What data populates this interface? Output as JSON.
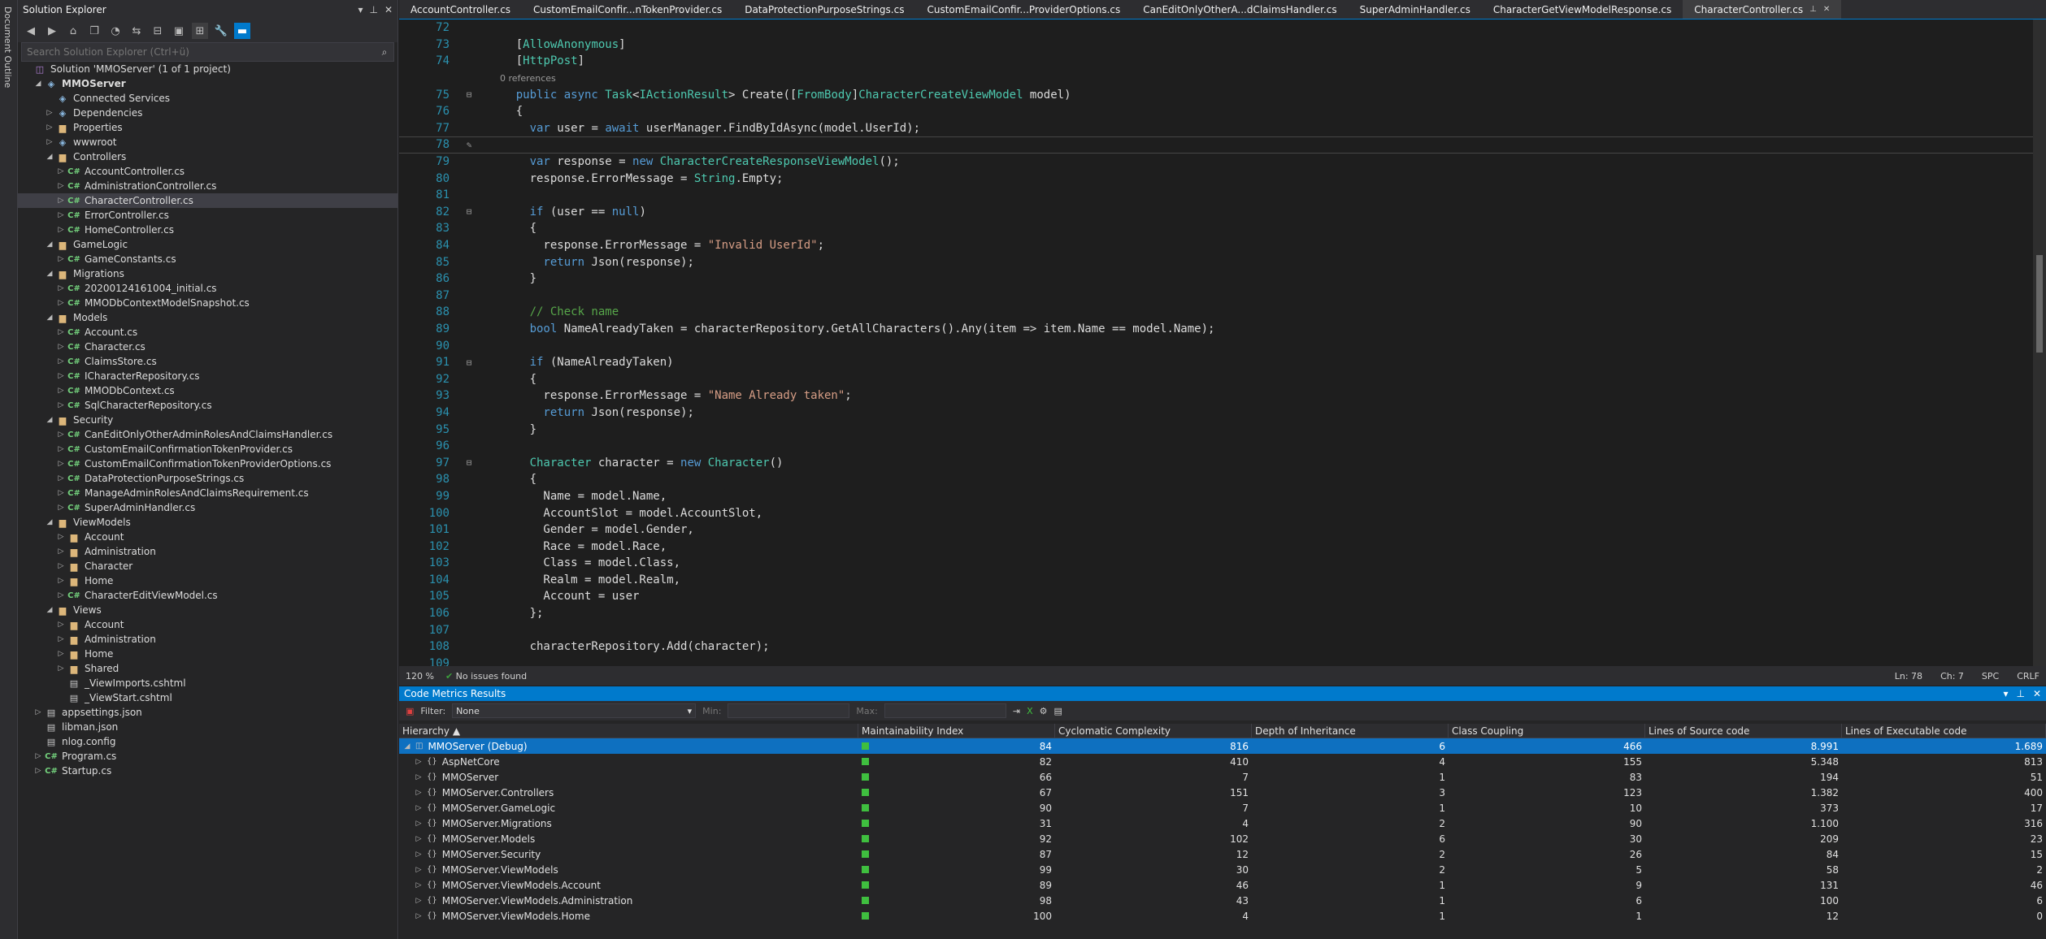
{
  "doc_outline": {
    "label": "Document Outline"
  },
  "solution_explorer": {
    "title": "Solution Explorer",
    "search_placeholder": "Search Solution Explorer (Ctrl+ü)",
    "tree": [
      {
        "label": "Solution 'MMOServer' (1 of 1 project)",
        "indent": 0,
        "icon": "sln",
        "arrow": ""
      },
      {
        "label": "MMOServer",
        "indent": 1,
        "icon": "proj",
        "arrow": "open",
        "bold": true
      },
      {
        "label": "Connected Services",
        "indent": 2,
        "icon": "proj",
        "arrow": ""
      },
      {
        "label": "Dependencies",
        "indent": 2,
        "icon": "proj",
        "arrow": "closed"
      },
      {
        "label": "Properties",
        "indent": 2,
        "icon": "folder",
        "arrow": "closed"
      },
      {
        "label": "wwwroot",
        "indent": 2,
        "icon": "proj",
        "arrow": "closed"
      },
      {
        "label": "Controllers",
        "indent": 2,
        "icon": "folder",
        "arrow": "open"
      },
      {
        "label": "AccountController.cs",
        "indent": 3,
        "icon": "cs",
        "arrow": "closed"
      },
      {
        "label": "AdministrationController.cs",
        "indent": 3,
        "icon": "cs",
        "arrow": "closed"
      },
      {
        "label": "CharacterController.cs",
        "indent": 3,
        "icon": "cs",
        "arrow": "closed",
        "selected": true
      },
      {
        "label": "ErrorController.cs",
        "indent": 3,
        "icon": "cs",
        "arrow": "closed"
      },
      {
        "label": "HomeController.cs",
        "indent": 3,
        "icon": "cs",
        "arrow": "closed"
      },
      {
        "label": "GameLogic",
        "indent": 2,
        "icon": "folder",
        "arrow": "open"
      },
      {
        "label": "GameConstants.cs",
        "indent": 3,
        "icon": "cs",
        "arrow": "closed"
      },
      {
        "label": "Migrations",
        "indent": 2,
        "icon": "folder",
        "arrow": "open"
      },
      {
        "label": "20200124161004_initial.cs",
        "indent": 3,
        "icon": "cs",
        "arrow": "closed"
      },
      {
        "label": "MMODbContextModelSnapshot.cs",
        "indent": 3,
        "icon": "cs",
        "arrow": "closed"
      },
      {
        "label": "Models",
        "indent": 2,
        "icon": "folder",
        "arrow": "open"
      },
      {
        "label": "Account.cs",
        "indent": 3,
        "icon": "cs",
        "arrow": "closed"
      },
      {
        "label": "Character.cs",
        "indent": 3,
        "icon": "cs",
        "arrow": "closed"
      },
      {
        "label": "ClaimsStore.cs",
        "indent": 3,
        "icon": "cs",
        "arrow": "closed"
      },
      {
        "label": "ICharacterRepository.cs",
        "indent": 3,
        "icon": "cs",
        "arrow": "closed"
      },
      {
        "label": "MMODbContext.cs",
        "indent": 3,
        "icon": "cs",
        "arrow": "closed"
      },
      {
        "label": "SqlCharacterRepository.cs",
        "indent": 3,
        "icon": "cs",
        "arrow": "closed"
      },
      {
        "label": "Security",
        "indent": 2,
        "icon": "folder",
        "arrow": "open"
      },
      {
        "label": "CanEditOnlyOtherAdminRolesAndClaimsHandler.cs",
        "indent": 3,
        "icon": "cs",
        "arrow": "closed"
      },
      {
        "label": "CustomEmailConfirmationTokenProvider.cs",
        "indent": 3,
        "icon": "cs",
        "arrow": "closed"
      },
      {
        "label": "CustomEmailConfirmationTokenProviderOptions.cs",
        "indent": 3,
        "icon": "cs",
        "arrow": "closed"
      },
      {
        "label": "DataProtectionPurposeStrings.cs",
        "indent": 3,
        "icon": "cs",
        "arrow": "closed"
      },
      {
        "label": "ManageAdminRolesAndClaimsRequirement.cs",
        "indent": 3,
        "icon": "cs",
        "arrow": "closed"
      },
      {
        "label": "SuperAdminHandler.cs",
        "indent": 3,
        "icon": "cs",
        "arrow": "closed"
      },
      {
        "label": "ViewModels",
        "indent": 2,
        "icon": "folder",
        "arrow": "open"
      },
      {
        "label": "Account",
        "indent": 3,
        "icon": "folder",
        "arrow": "closed"
      },
      {
        "label": "Administration",
        "indent": 3,
        "icon": "folder",
        "arrow": "closed"
      },
      {
        "label": "Character",
        "indent": 3,
        "icon": "folder",
        "arrow": "closed"
      },
      {
        "label": "Home",
        "indent": 3,
        "icon": "folder",
        "arrow": "closed"
      },
      {
        "label": "CharacterEditViewModel.cs",
        "indent": 3,
        "icon": "cs",
        "arrow": "closed"
      },
      {
        "label": "Views",
        "indent": 2,
        "icon": "folder",
        "arrow": "open"
      },
      {
        "label": "Account",
        "indent": 3,
        "icon": "folder",
        "arrow": "closed"
      },
      {
        "label": "Administration",
        "indent": 3,
        "icon": "folder",
        "arrow": "closed"
      },
      {
        "label": "Home",
        "indent": 3,
        "icon": "folder",
        "arrow": "closed"
      },
      {
        "label": "Shared",
        "indent": 3,
        "icon": "folder",
        "arrow": "closed"
      },
      {
        "label": "_ViewImports.cshtml",
        "indent": 3,
        "icon": "file",
        "arrow": ""
      },
      {
        "label": "_ViewStart.cshtml",
        "indent": 3,
        "icon": "file",
        "arrow": ""
      },
      {
        "label": "appsettings.json",
        "indent": 1,
        "icon": "file",
        "arrow": "closed"
      },
      {
        "label": "libman.json",
        "indent": 1,
        "icon": "file",
        "arrow": ""
      },
      {
        "label": "nlog.config",
        "indent": 1,
        "icon": "file",
        "arrow": ""
      },
      {
        "label": "Program.cs",
        "indent": 1,
        "icon": "cs",
        "arrow": "closed"
      },
      {
        "label": "Startup.cs",
        "indent": 1,
        "icon": "cs",
        "arrow": "closed"
      }
    ]
  },
  "tabs": [
    {
      "label": "AccountController.cs",
      "active": false
    },
    {
      "label": "CustomEmailConfir...nTokenProvider.cs",
      "active": false
    },
    {
      "label": "DataProtectionPurposeStrings.cs",
      "active": false
    },
    {
      "label": "CustomEmailConfir...ProviderOptions.cs",
      "active": false
    },
    {
      "label": "CanEditOnlyOtherA...dClaimsHandler.cs",
      "active": false
    },
    {
      "label": "SuperAdminHandler.cs",
      "active": false
    },
    {
      "label": "CharacterGetViewModelResponse.cs",
      "active": false
    },
    {
      "label": "CharacterController.cs",
      "active": true
    }
  ],
  "code_lines": [
    {
      "n": "72",
      "parts": [
        [
          "t",
          ""
        ]
      ]
    },
    {
      "n": "73",
      "parts": [
        [
          "t",
          "    ["
        ],
        [
          "ty",
          "AllowAnonymous"
        ],
        [
          "t",
          "]"
        ]
      ]
    },
    {
      "n": "74",
      "parts": [
        [
          "t",
          "    ["
        ],
        [
          "ty",
          "HttpPost"
        ],
        [
          "t",
          "]"
        ]
      ]
    },
    {
      "n": "",
      "parts": [
        [
          "rf",
          "    0 references"
        ]
      ]
    },
    {
      "n": "75",
      "fold": true,
      "parts": [
        [
          "kw",
          "    public async "
        ],
        [
          "ty",
          "Task"
        ],
        [
          "t",
          "<"
        ],
        [
          "ty",
          "IActionResult"
        ],
        [
          "t",
          "> Create(["
        ],
        [
          "ty",
          "FromBody"
        ],
        [
          "t",
          "]"
        ],
        [
          "ty",
          "CharacterCreateViewModel"
        ],
        [
          "t",
          " model)"
        ]
      ]
    },
    {
      "n": "76",
      "parts": [
        [
          "t",
          "    {"
        ]
      ]
    },
    {
      "n": "77",
      "parts": [
        [
          "kw",
          "      var "
        ],
        [
          "t",
          "user = "
        ],
        [
          "kw",
          "await "
        ],
        [
          "t",
          "userManager.FindByIdAsync(model.UserId);"
        ]
      ]
    },
    {
      "n": "78",
      "cur": true,
      "parts": [
        [
          "t",
          ""
        ]
      ]
    },
    {
      "n": "79",
      "parts": [
        [
          "kw",
          "      var "
        ],
        [
          "t",
          "response = "
        ],
        [
          "kw",
          "new "
        ],
        [
          "ty",
          "CharacterCreateResponseViewModel"
        ],
        [
          "t",
          "();"
        ]
      ]
    },
    {
      "n": "80",
      "parts": [
        [
          "t",
          "      response.ErrorMessage = "
        ],
        [
          "ty",
          "String"
        ],
        [
          "t",
          ".Empty;"
        ]
      ]
    },
    {
      "n": "81",
      "parts": [
        [
          "t",
          ""
        ]
      ]
    },
    {
      "n": "82",
      "fold": true,
      "parts": [
        [
          "kw",
          "      if "
        ],
        [
          "t",
          "(user == "
        ],
        [
          "kw",
          "null"
        ],
        [
          "t",
          ")"
        ]
      ]
    },
    {
      "n": "83",
      "parts": [
        [
          "t",
          "      {"
        ]
      ]
    },
    {
      "n": "84",
      "parts": [
        [
          "t",
          "        response.ErrorMessage = "
        ],
        [
          "st",
          "\"Invalid UserId\""
        ],
        [
          "t",
          ";"
        ]
      ]
    },
    {
      "n": "85",
      "parts": [
        [
          "kw",
          "        return "
        ],
        [
          "t",
          "Json(response);"
        ]
      ]
    },
    {
      "n": "86",
      "parts": [
        [
          "t",
          "      }"
        ]
      ]
    },
    {
      "n": "87",
      "parts": [
        [
          "t",
          ""
        ]
      ]
    },
    {
      "n": "88",
      "parts": [
        [
          "cm",
          "      // Check name"
        ]
      ]
    },
    {
      "n": "89",
      "parts": [
        [
          "kw",
          "      bool "
        ],
        [
          "t",
          "NameAlreadyTaken = characterRepository.GetAllCharacters().Any(item => item.Name == model.Name);"
        ]
      ]
    },
    {
      "n": "90",
      "parts": [
        [
          "t",
          ""
        ]
      ]
    },
    {
      "n": "91",
      "fold": true,
      "parts": [
        [
          "kw",
          "      if "
        ],
        [
          "t",
          "(NameAlreadyTaken)"
        ]
      ]
    },
    {
      "n": "92",
      "parts": [
        [
          "t",
          "      {"
        ]
      ]
    },
    {
      "n": "93",
      "parts": [
        [
          "t",
          "        response.ErrorMessage = "
        ],
        [
          "st",
          "\"Name Already taken\""
        ],
        [
          "t",
          ";"
        ]
      ]
    },
    {
      "n": "94",
      "parts": [
        [
          "kw",
          "        return "
        ],
        [
          "t",
          "Json(response);"
        ]
      ]
    },
    {
      "n": "95",
      "parts": [
        [
          "t",
          "      }"
        ]
      ]
    },
    {
      "n": "96",
      "parts": [
        [
          "t",
          ""
        ]
      ]
    },
    {
      "n": "97",
      "fold": true,
      "parts": [
        [
          "ty",
          "      Character "
        ],
        [
          "t",
          "character = "
        ],
        [
          "kw",
          "new "
        ],
        [
          "ty",
          "Character"
        ],
        [
          "t",
          "()"
        ]
      ]
    },
    {
      "n": "98",
      "parts": [
        [
          "t",
          "      {"
        ]
      ]
    },
    {
      "n": "99",
      "parts": [
        [
          "t",
          "        Name = model.Name,"
        ]
      ]
    },
    {
      "n": "100",
      "parts": [
        [
          "t",
          "        AccountSlot = model.AccountSlot,"
        ]
      ]
    },
    {
      "n": "101",
      "parts": [
        [
          "t",
          "        Gender = model.Gender,"
        ]
      ]
    },
    {
      "n": "102",
      "parts": [
        [
          "t",
          "        Race = model.Race,"
        ]
      ]
    },
    {
      "n": "103",
      "parts": [
        [
          "t",
          "        Class = model.Class,"
        ]
      ]
    },
    {
      "n": "104",
      "parts": [
        [
          "t",
          "        Realm = model.Realm,"
        ]
      ]
    },
    {
      "n": "105",
      "parts": [
        [
          "t",
          "        Account = user"
        ]
      ]
    },
    {
      "n": "106",
      "parts": [
        [
          "t",
          "      };"
        ]
      ]
    },
    {
      "n": "107",
      "parts": [
        [
          "t",
          ""
        ]
      ]
    },
    {
      "n": "108",
      "parts": [
        [
          "t",
          "      characterRepository.Add(character);"
        ]
      ]
    },
    {
      "n": "109",
      "parts": [
        [
          "t",
          ""
        ]
      ]
    }
  ],
  "editor_status": {
    "zoom": "120 %",
    "issues": "No issues found",
    "ln": "Ln: 78",
    "ch": "Ch: 7",
    "spc": "SPC",
    "crlf": "CRLF"
  },
  "code_metrics": {
    "title": "Code Metrics Results",
    "filter_label": "Filter:",
    "filter_value": "None",
    "min_label": "Min:",
    "max_label": "Max:",
    "columns": [
      "Hierarchy",
      "Maintainability Index",
      "Cyclomatic Complexity",
      "Depth of Inheritance",
      "Class Coupling",
      "Lines of Source code",
      "Lines of Executable code"
    ],
    "rows": [
      {
        "name": "MMOServer (Debug)",
        "mi": "84",
        "cc": "816",
        "di": "6",
        "coup": "466",
        "los": "8.991",
        "loe": "1.689",
        "selected": true,
        "top": true
      },
      {
        "name": "AspNetCore",
        "mi": "82",
        "cc": "410",
        "di": "4",
        "coup": "155",
        "los": "5.348",
        "loe": "813"
      },
      {
        "name": "MMOServer",
        "mi": "66",
        "cc": "7",
        "di": "1",
        "coup": "83",
        "los": "194",
        "loe": "51"
      },
      {
        "name": "MMOServer.Controllers",
        "mi": "67",
        "cc": "151",
        "di": "3",
        "coup": "123",
        "los": "1.382",
        "loe": "400"
      },
      {
        "name": "MMOServer.GameLogic",
        "mi": "90",
        "cc": "7",
        "di": "1",
        "coup": "10",
        "los": "373",
        "loe": "17"
      },
      {
        "name": "MMOServer.Migrations",
        "mi": "31",
        "cc": "4",
        "di": "2",
        "coup": "90",
        "los": "1.100",
        "loe": "316"
      },
      {
        "name": "MMOServer.Models",
        "mi": "92",
        "cc": "102",
        "di": "6",
        "coup": "30",
        "los": "209",
        "loe": "23"
      },
      {
        "name": "MMOServer.Security",
        "mi": "87",
        "cc": "12",
        "di": "2",
        "coup": "26",
        "los": "84",
        "loe": "15"
      },
      {
        "name": "MMOServer.ViewModels",
        "mi": "99",
        "cc": "30",
        "di": "2",
        "coup": "5",
        "los": "58",
        "loe": "2"
      },
      {
        "name": "MMOServer.ViewModels.Account",
        "mi": "89",
        "cc": "46",
        "di": "1",
        "coup": "9",
        "los": "131",
        "loe": "46"
      },
      {
        "name": "MMOServer.ViewModels.Administration",
        "mi": "98",
        "cc": "43",
        "di": "1",
        "coup": "6",
        "los": "100",
        "loe": "6"
      },
      {
        "name": "MMOServer.ViewModels.Home",
        "mi": "100",
        "cc": "4",
        "di": "1",
        "coup": "1",
        "los": "12",
        "loe": "0"
      }
    ]
  },
  "colors": {
    "accent": "#007acc",
    "selection": "#0e70c0",
    "good_index": "#3fbf3f"
  }
}
